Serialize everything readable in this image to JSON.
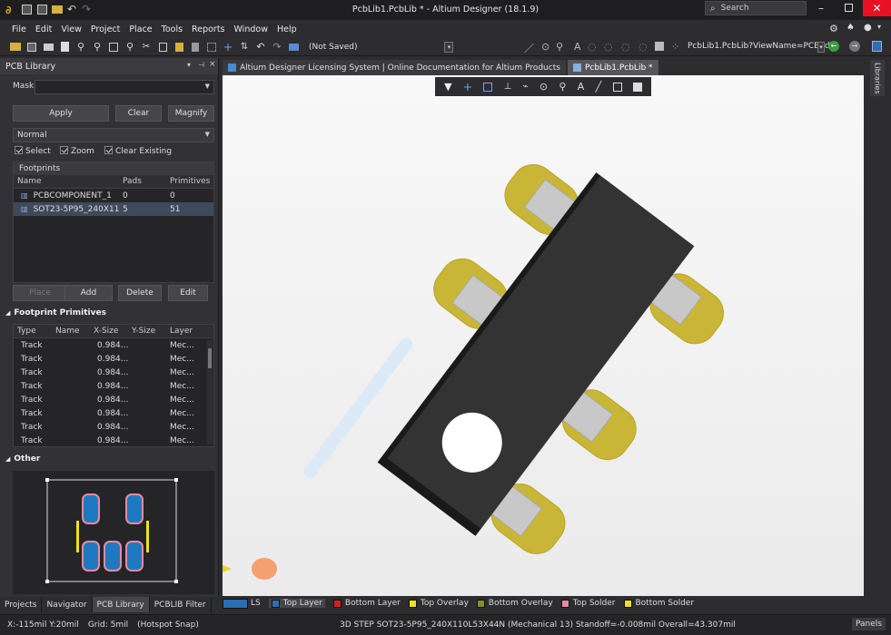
{
  "window": {
    "title": "PcbLib1.PcbLib * - Altium Designer (18.1.9)",
    "search_placeholder": "Search"
  },
  "menu": [
    "File",
    "Edit",
    "View",
    "Project",
    "Place",
    "Tools",
    "Reports",
    "Window",
    "Help"
  ],
  "toolbar": {
    "status": "(Not Saved)",
    "address": "PcbLib1.PcbLib?ViewName=PCBEd"
  },
  "panel": {
    "title": "PCB Library",
    "mask_label": "Mask",
    "apply": "Apply",
    "clear": "Clear",
    "magnify": "Magnify",
    "mode": "Normal",
    "checks": [
      "Select",
      "Zoom",
      "Clear Existing"
    ],
    "footprints_header": "Footprints",
    "fp_columns": [
      "Name",
      "Pads",
      "Primitives"
    ],
    "footprints": [
      {
        "name": "PCBCOMPONENT_1",
        "pads": "0",
        "primitives": "0"
      },
      {
        "name": "SOT23-5P95_240X110L5...",
        "pads": "5",
        "primitives": "51"
      }
    ],
    "place": "Place",
    "add": "Add",
    "delete": "Delete",
    "edit": "Edit",
    "primitives_header": "Footprint Primitives",
    "prim_columns": [
      "Type",
      "Name",
      "X-Size",
      "Y-Size",
      "Layer"
    ],
    "primitives": [
      {
        "type": "Track",
        "x": "0.984...",
        "layer": "Mec..."
      },
      {
        "type": "Track",
        "x": "0.984...",
        "layer": "Mec..."
      },
      {
        "type": "Track",
        "x": "0.984...",
        "layer": "Mec..."
      },
      {
        "type": "Track",
        "x": "0.984...",
        "layer": "Mec..."
      },
      {
        "type": "Track",
        "x": "0.984...",
        "layer": "Mec..."
      },
      {
        "type": "Track",
        "x": "0.984...",
        "layer": "Mec..."
      },
      {
        "type": "Track",
        "x": "0.984...",
        "layer": "Mec..."
      },
      {
        "type": "Track",
        "x": "0.984...",
        "layer": "Mec..."
      }
    ],
    "other_header": "Other"
  },
  "bottom_tabs": [
    "Projects",
    "Navigator",
    "PCB Library",
    "PCBLIB Filter"
  ],
  "doc_tabs": [
    "Altium Designer Licensing System | Online Documentation for Altium Products",
    "PcbLib1.PcbLib *"
  ],
  "right_rail": "Libraries",
  "layers": [
    {
      "name": "LS",
      "color": "#2a6fb5"
    },
    {
      "name": "Top Layer",
      "color": "#2a6fb5"
    },
    {
      "name": "Bottom Layer",
      "color": "#d02020"
    },
    {
      "name": "Top Overlay",
      "color": "#f0e020"
    },
    {
      "name": "Bottom Overlay",
      "color": "#8a8a30"
    },
    {
      "name": "Top Solder",
      "color": "#e88aa0"
    },
    {
      "name": "Bottom Solder",
      "color": "#f0e020"
    }
  ],
  "status": {
    "coords": "X:-115mil Y:20mil",
    "grid": "Grid: 5mil",
    "snap": "(Hotspot Snap)",
    "info": "3D STEP SOT23-5P95_240X110L53X44N (Mechanical 13)  Standoff=-0.008mil  Overall=43.307mil",
    "panels": "Panels"
  }
}
